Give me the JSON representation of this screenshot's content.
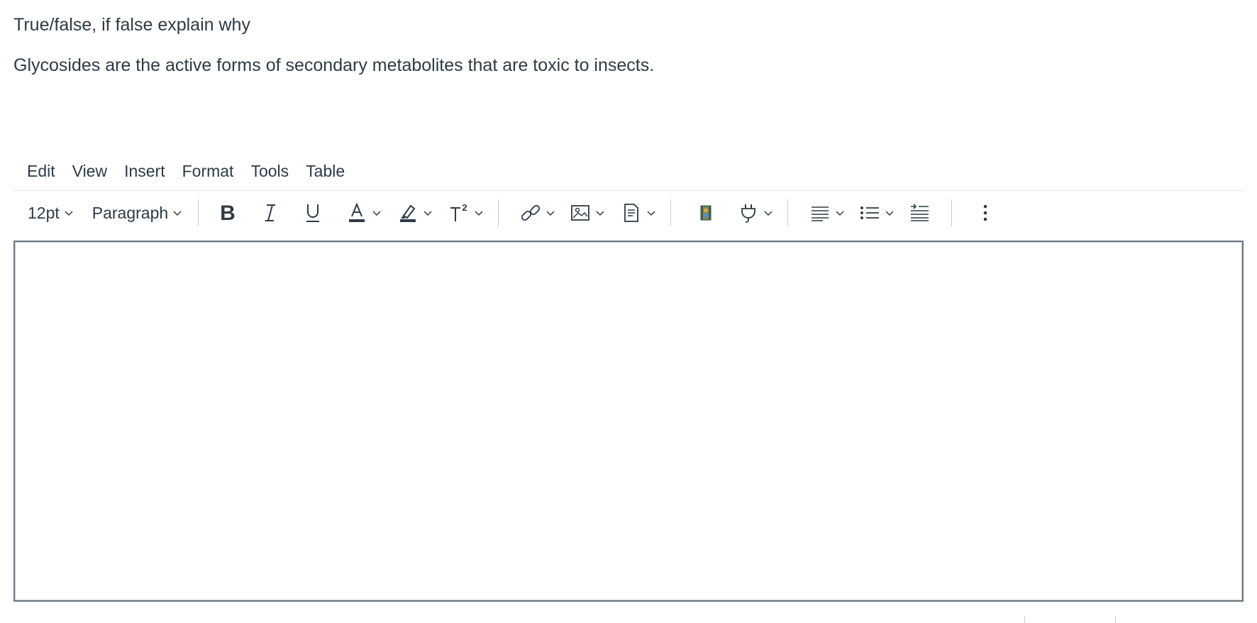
{
  "question": {
    "prompt": "True/false, if false explain why",
    "statement": "Glycosides are the active forms of secondary metabolites that are toxic to insects."
  },
  "menubar": {
    "items": [
      "Edit",
      "View",
      "Insert",
      "Format",
      "Tools",
      "Table"
    ]
  },
  "toolbar": {
    "font_size": "12pt",
    "block_format": "Paragraph",
    "superscript_label": "T²"
  },
  "editor": {
    "content": ""
  },
  "colors": {
    "text": "#2d3b45",
    "border": "#6b7780",
    "divider": "#c7cdd1",
    "text_color_swatch": "#2d3b45",
    "highlight_swatch": "#2d3b45"
  },
  "icons": [
    "bold-icon",
    "italic-icon",
    "underline-icon",
    "text-color-icon",
    "highlight-icon",
    "superscript-icon",
    "link-icon",
    "image-icon",
    "document-icon",
    "media-icon",
    "plugin-icon",
    "align-icon",
    "list-icon",
    "indent-icon",
    "more-options-icon"
  ]
}
